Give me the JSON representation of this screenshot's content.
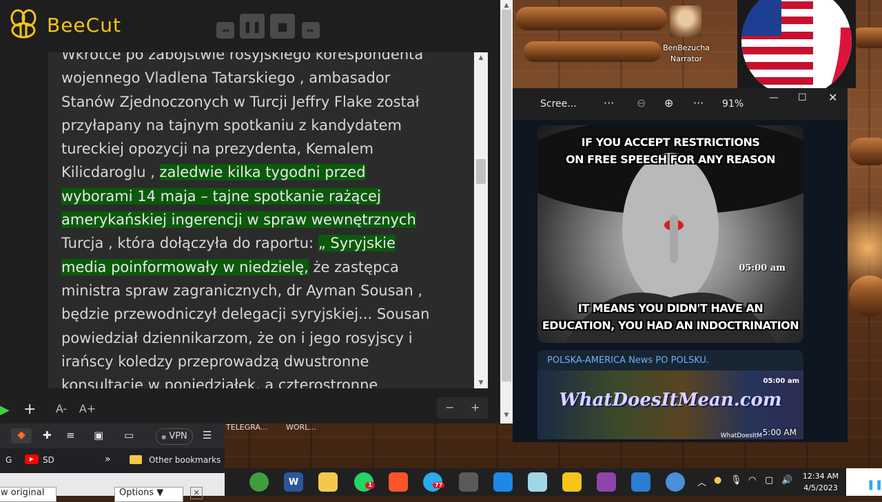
{
  "beecut": {
    "title": "BeeCut"
  },
  "reader": {
    "line0": "Wkrótce po zabójstwie rosyjskiego korespondenta",
    "line1": "wojennego Vladlena Tatarskiego , ambasador",
    "line2": "Stanów Zjednoczonych w Turcji Jeffry Flake został",
    "line3": "przyłapany na tajnym spotkaniu z kandydatem",
    "line4": "tureckiej opozycji na prezydenta, Kemalem",
    "line5a": "Kilicdaroglu , ",
    "line5b": "zaledwie kilka tygodni przed",
    "line6": "wyborami 14 maja – tajne spotkanie rażącej",
    "line7": "amerykańskiej ingerencji w spraw wewnętrznych",
    "line8a": "Turcja , która dołączyła do raportu: ",
    "line8b": "„ Syryjskie",
    "line9a": "media poinformowały w niedzielę,",
    "line9b": " że zastępca",
    "line10": "ministra spraw zagranicznych, dr Ayman Sousan ,",
    "line11": "będzie przewodniczył delegacji syryjskiej... Sousan",
    "line12": "powiedział dziennikarzom, że on i jego rosyjscy i",
    "line13": "irańscy koledzy przeprowadzą dwustronne",
    "line14": "konsultacje w poniedziałek, a czterostronne",
    "font_decrease": "A-",
    "font_increase": "A+",
    "zoom_minus": "−",
    "zoom_plus": "+"
  },
  "browser": {
    "tab1": "TELEGRA...",
    "tab2": "WORL...",
    "vpn": "VPN",
    "bookmark_g": "G",
    "bookmark_sd": "SD",
    "more": "»",
    "other_bookmarks": "Other bookmarks",
    "show_original": "w original",
    "options": "Options ▼",
    "close": "✕"
  },
  "narrator": {
    "name": "BenBezucha",
    "role": "Narrator"
  },
  "viewer": {
    "title": "Scree...",
    "zoom": "91%",
    "meme_top1": "IF YOU ACCEPT RESTRICTIONS",
    "meme_top2": "ON FREE SPEECH FOR ANY REASON",
    "meme_time": "05:00 am",
    "meme_bottom1": "IT MEANS YOU DIDN'T HAVE AN",
    "meme_bottom2": "EDUCATION, YOU HAD AN INDOCTRINATION",
    "channel_name": "POLSKA-AMERICA News PO POLSKU.",
    "channel_image_text": "WhatDoesItMean.com",
    "channel_time_top": "05:00 am",
    "channel_brand": "WhatDoesItM",
    "channel_time": "5:00 AM"
  },
  "taskbar": {
    "word": "W",
    "telegram_badge": "77",
    "whatsapp_badge": "1",
    "time": "12:34 AM",
    "date": "4/5/2023"
  }
}
